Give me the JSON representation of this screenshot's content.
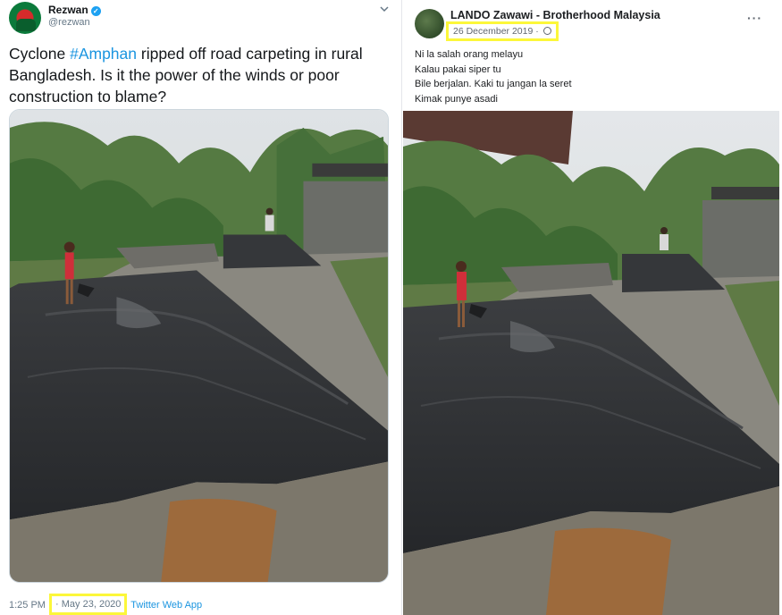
{
  "tweet": {
    "author_name": "Rezwan",
    "author_handle": "@rezwan",
    "verified_icon": "verified-badge-icon",
    "text_before": "Cyclone ",
    "hashtag": "#Amphan",
    "text_after": " ripped off  road carpeting in rural Bangladesh. Is it the power of the winds or poor construction to blame?",
    "time": "1:25 PM",
    "separator": "·",
    "date": "May 23, 2020",
    "app": "Twitter Web App",
    "menu_icon": "chevron-down-icon"
  },
  "facebook": {
    "author_name": "LANDO Zawawi - Brotherhood Malaysia",
    "date": "26 December 2019",
    "dot": "·",
    "privacy_icon": "globe-icon",
    "more_icon": "more-options-icon",
    "more_label": "···",
    "lines": [
      "Ni la salah orang melayu",
      "Kalau pakai siper  tu",
      "Bile berjalan. Kaki tu jangan la seret",
      "Kimak punye asadi"
    ]
  },
  "colors": {
    "highlight_box": "#fcf73a",
    "twitter_link": "#1b95e0",
    "asphalt": "#2e3033",
    "foliage": "#4e7a3a"
  }
}
